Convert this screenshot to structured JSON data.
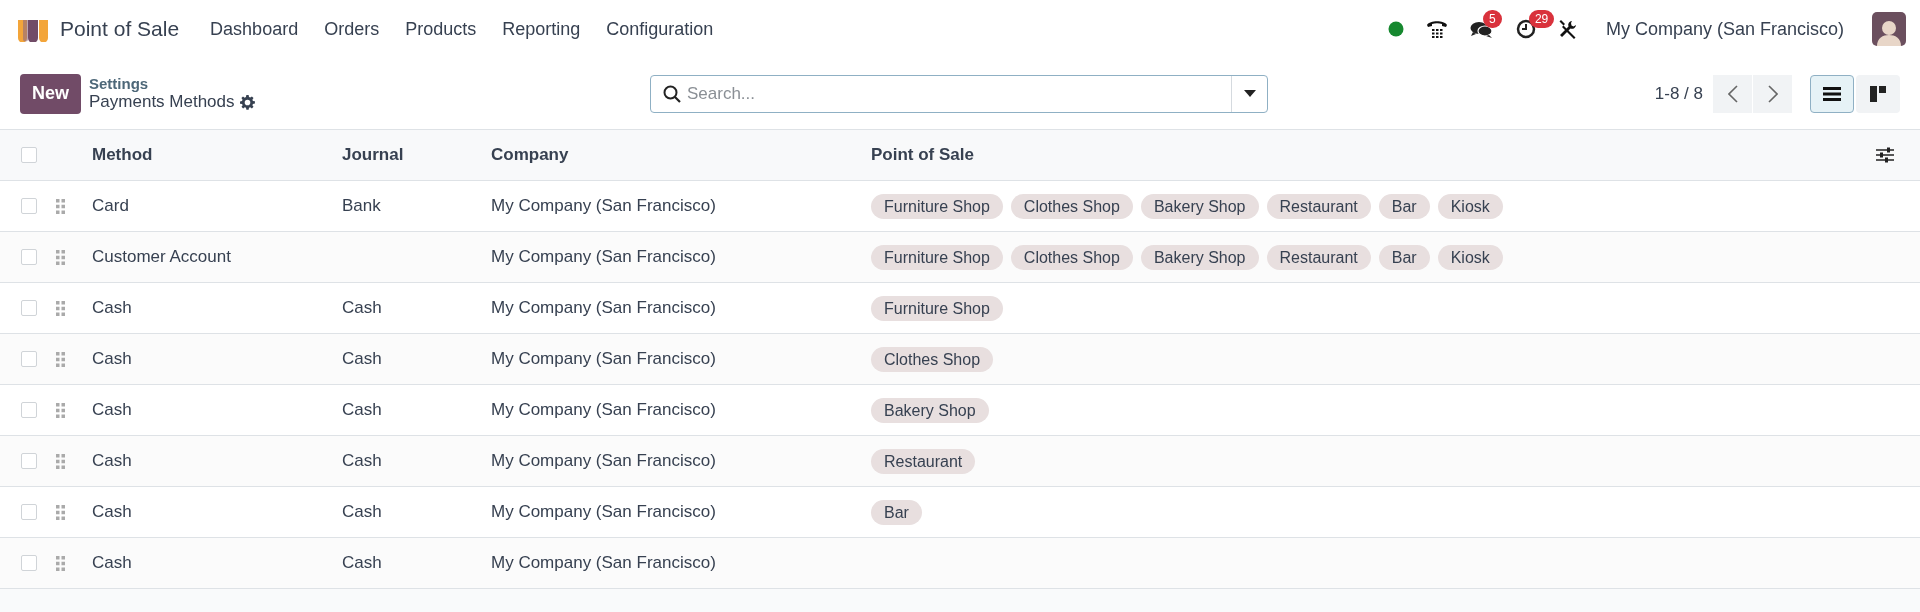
{
  "navbar": {
    "app_name": "Point of Sale",
    "menu": [
      "Dashboard",
      "Orders",
      "Products",
      "Reporting",
      "Configuration"
    ],
    "systray": {
      "messages_badge": "5",
      "activities_badge": "29",
      "company": "My Company (San Francisco)"
    }
  },
  "control_panel": {
    "new_button": "New",
    "breadcrumb": "Settings",
    "title": "Payments Methods",
    "search": {
      "placeholder": "Search..."
    },
    "pager": "1-8 / 8",
    "views": [
      {
        "kind": "list",
        "selected": true
      },
      {
        "kind": "kanban",
        "selected": false
      }
    ]
  },
  "table": {
    "select_all_checked": false,
    "columns": [
      "Method",
      "Journal",
      "Company",
      "Point of Sale"
    ],
    "rows": [
      {
        "checked": false,
        "method": "Card",
        "journal": "Bank",
        "company": "My Company (San Francisco)",
        "point_of_sale": [
          "Furniture Shop",
          "Clothes Shop",
          "Bakery Shop",
          "Restaurant",
          "Bar",
          "Kiosk"
        ]
      },
      {
        "checked": false,
        "method": "Customer Account",
        "company": "My Company (San Francisco)",
        "point_of_sale": [
          "Furniture Shop",
          "Clothes Shop",
          "Bakery Shop",
          "Restaurant",
          "Bar",
          "Kiosk"
        ]
      },
      {
        "checked": false,
        "method": "Cash",
        "journal": "Cash",
        "company": "My Company (San Francisco)",
        "point_of_sale": [
          "Furniture Shop"
        ]
      },
      {
        "checked": false,
        "method": "Cash",
        "journal": "Cash",
        "company": "My Company (San Francisco)",
        "point_of_sale": [
          "Clothes Shop"
        ]
      },
      {
        "checked": false,
        "method": "Cash",
        "journal": "Cash",
        "company": "My Company (San Francisco)",
        "point_of_sale": [
          "Bakery Shop"
        ]
      },
      {
        "checked": false,
        "method": "Cash",
        "journal": "Cash",
        "company": "My Company (San Francisco)",
        "point_of_sale": [
          "Restaurant"
        ]
      },
      {
        "checked": false,
        "method": "Cash",
        "journal": "Cash",
        "company": "My Company (San Francisco)",
        "point_of_sale": [
          "Bar"
        ]
      },
      {
        "checked": false,
        "method": "Cash",
        "journal": "Cash",
        "company": "My Company (San Francisco)"
      }
    ]
  }
}
